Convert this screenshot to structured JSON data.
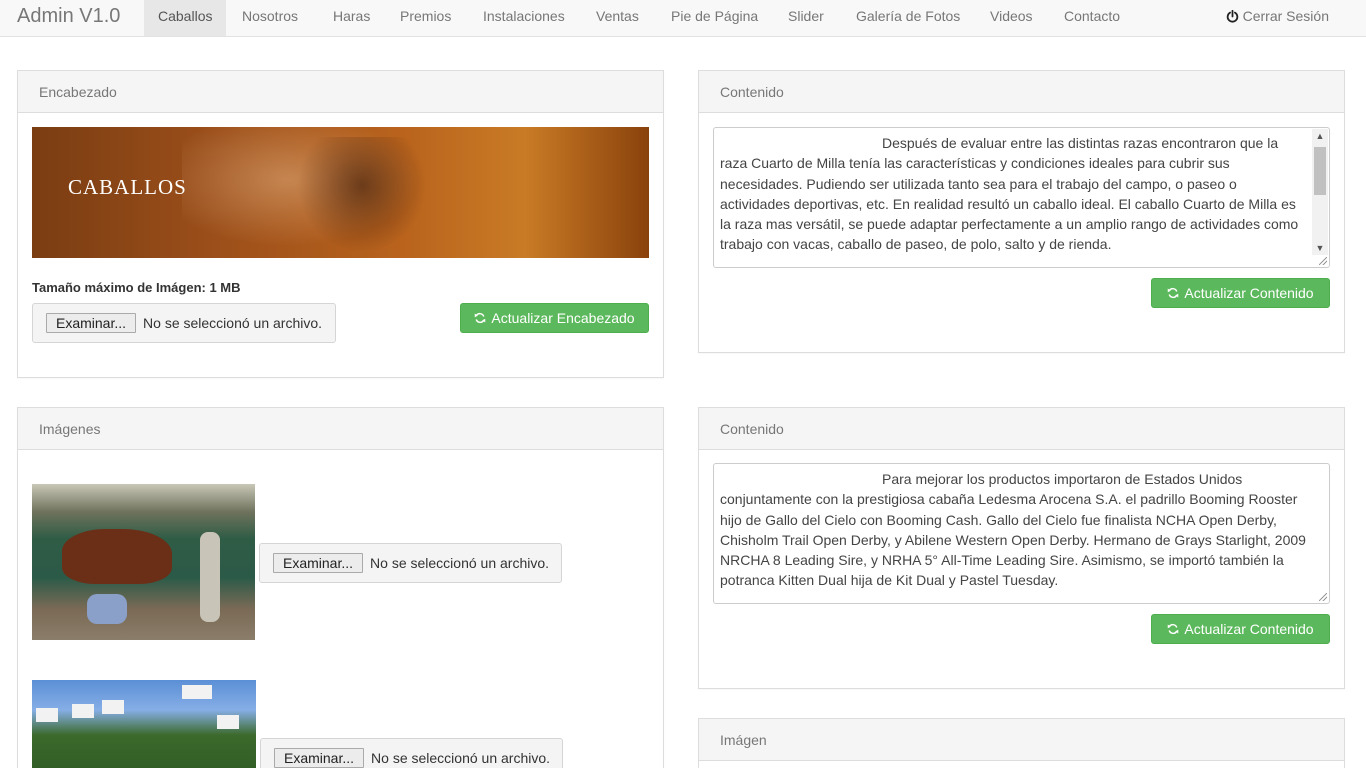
{
  "navbar": {
    "brand": "Admin V1.0",
    "items": [
      {
        "label": "Caballos",
        "active": true
      },
      {
        "label": "Nosotros"
      },
      {
        "label": "Haras"
      },
      {
        "label": "Premios"
      },
      {
        "label": "Instalaciones"
      },
      {
        "label": "Ventas"
      },
      {
        "label": "Pie de Página"
      },
      {
        "label": "Slider"
      },
      {
        "label": "Galería de Fotos"
      },
      {
        "label": "Videos"
      },
      {
        "label": "Contacto"
      }
    ],
    "logout_label": "Cerrar Sesión",
    "logout_icon": "power-icon"
  },
  "encabezado": {
    "title": "Encabezado",
    "banner_text": "CABALLOS",
    "max_size_label": "Tamaño máximo de Imágen: 1 MB",
    "file_button": "Examinar...",
    "file_status": "No se seleccionó un archivo.",
    "update_button": "Actualizar Encabezado"
  },
  "contenido1": {
    "title": "Contenido",
    "text": "Después de evaluar entre las distintas razas encontraron que la raza Cuarto de Milla tenía las características y condiciones ideales para cubrir sus necesidades. Pudiendo ser utilizada tanto sea para el trabajo del campo, o paseo o actividades deportivas, etc. En realidad resultó un caballo ideal. El caballo Cuarto de Milla es la raza mas versátil, se puede adaptar perfectamente a un amplio rango de actividades como trabajo con vacas, caballo de paseo, de polo, salto y de rienda.",
    "update_button": "Actualizar Contenido"
  },
  "imagenes": {
    "title": "Imágenes",
    "items": [
      {
        "file_button": "Examinar...",
        "file_status": "No se seleccionó un archivo."
      },
      {
        "file_button": "Examinar...",
        "file_status": "No se seleccionó un archivo."
      }
    ]
  },
  "contenido2": {
    "title": "Contenido",
    "text": "Para mejorar los productos importaron de Estados Unidos conjuntamente con la prestigiosa cabaña Ledesma Arocena S.A. el padrillo Booming Rooster hijo de Gallo del Cielo con Booming Cash. Gallo del Cielo fue finalista NCHA Open Derby, Chisholm Trail Open Derby, y Abilene Western Open Derby. Hermano de Grays Starlight, 2009 NRCHA 8 Leading Sire, y NRHA 5° All-Time Leading Sire. Asimismo, se importó también la potranca Kitten Dual hija de Kit Dual y Pastel Tuesday.",
    "update_button": "Actualizar Contenido"
  },
  "imagen": {
    "title": "Imágen"
  },
  "colors": {
    "success": "#5cb85c",
    "navbar_bg": "#f8f8f8",
    "panel_heading_bg": "#f5f5f5"
  }
}
